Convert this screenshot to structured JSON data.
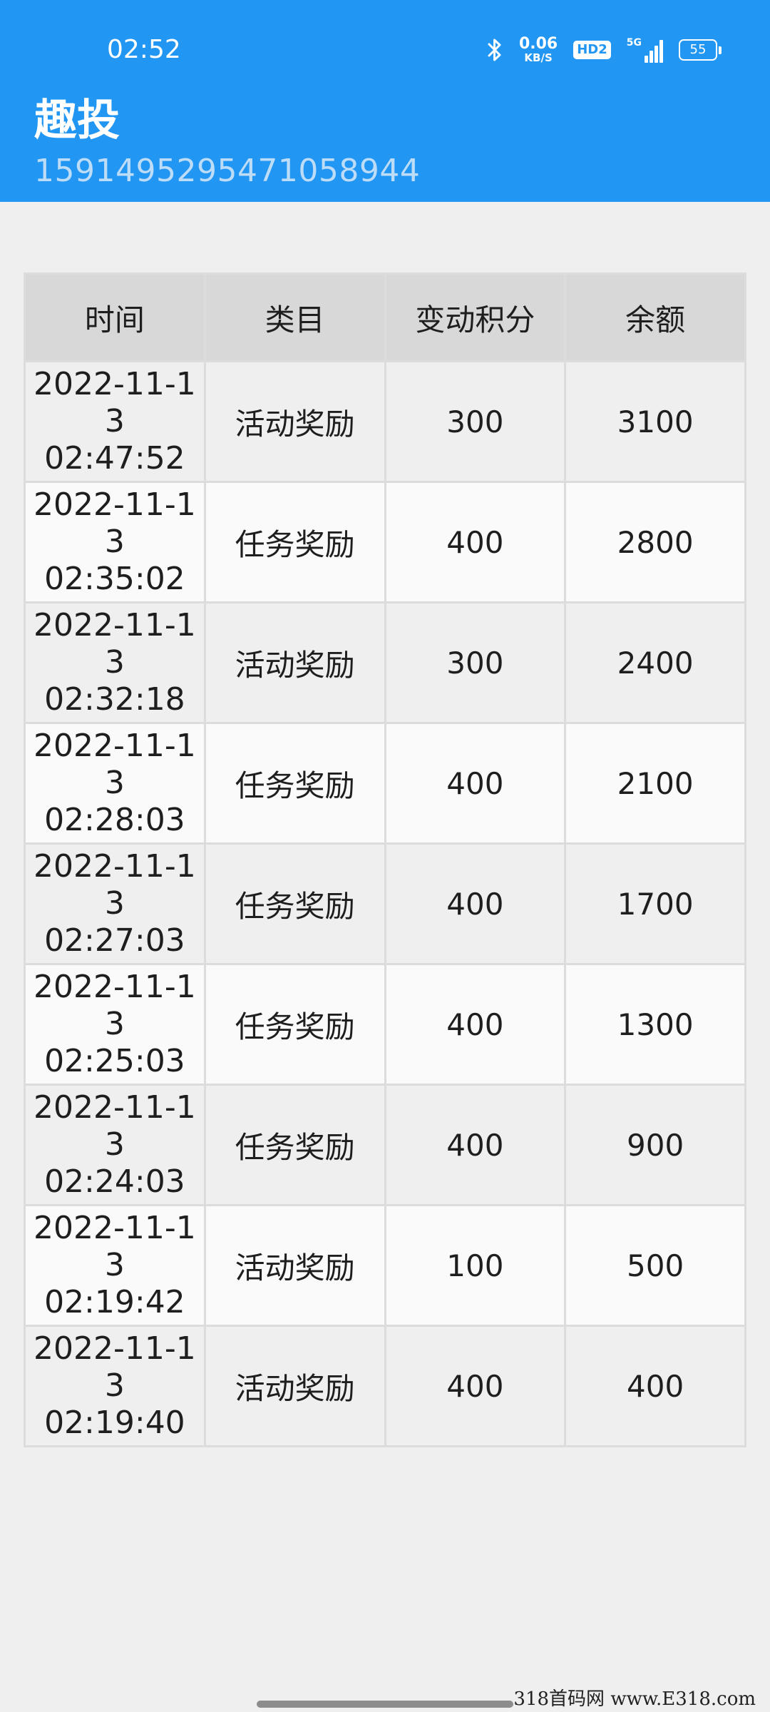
{
  "status_bar": {
    "time": "02:52",
    "bluetooth_icon": "bluetooth-icon",
    "net_speed_value": "0.06",
    "net_speed_unit": "KB/S",
    "hd_badge": "HD2",
    "signal_label": "5G",
    "signal_icon": "cellular-signal-icon",
    "battery_level": "55"
  },
  "header": {
    "title": "趣投",
    "subtitle": "15914952954710589​44"
  },
  "table": {
    "columns": [
      "时间",
      "类目",
      "变动积分",
      "余额"
    ],
    "rows": [
      {
        "time_line1": "2022-11-1",
        "time_line2": "3 02:47:52",
        "category": "活动奖励",
        "change": "300",
        "balance": "3100"
      },
      {
        "time_line1": "2022-11-1",
        "time_line2": "3 02:35:02",
        "category": "任务奖励",
        "change": "400",
        "balance": "2800"
      },
      {
        "time_line1": "2022-11-1",
        "time_line2": "3 02:32:18",
        "category": "活动奖励",
        "change": "300",
        "balance": "2400"
      },
      {
        "time_line1": "2022-11-1",
        "time_line2": "3 02:28:03",
        "category": "任务奖励",
        "change": "400",
        "balance": "2100"
      },
      {
        "time_line1": "2022-11-1",
        "time_line2": "3 02:27:03",
        "category": "任务奖励",
        "change": "400",
        "balance": "1700"
      },
      {
        "time_line1": "2022-11-1",
        "time_line2": "3 02:25:03",
        "category": "任务奖励",
        "change": "400",
        "balance": "1300"
      },
      {
        "time_line1": "2022-11-1",
        "time_line2": "3 02:24:03",
        "category": "任务奖励",
        "change": "400",
        "balance": "900"
      },
      {
        "time_line1": "2022-11-1",
        "time_line2": "3 02:19:42",
        "category": "活动奖励",
        "change": "100",
        "balance": "500"
      },
      {
        "time_line1": "2022-11-1",
        "time_line2": "3 02:19:40",
        "category": "活动奖励",
        "change": "400",
        "balance": "400"
      }
    ]
  },
  "watermark": "318首码网 www.E318.com",
  "colors": {
    "header_bg": "#2196f3",
    "subtitle": "#bcdcf8",
    "page_bg": "#efefef",
    "table_header_bg": "#d8d8d8",
    "table_border": "#dcdcdc"
  }
}
